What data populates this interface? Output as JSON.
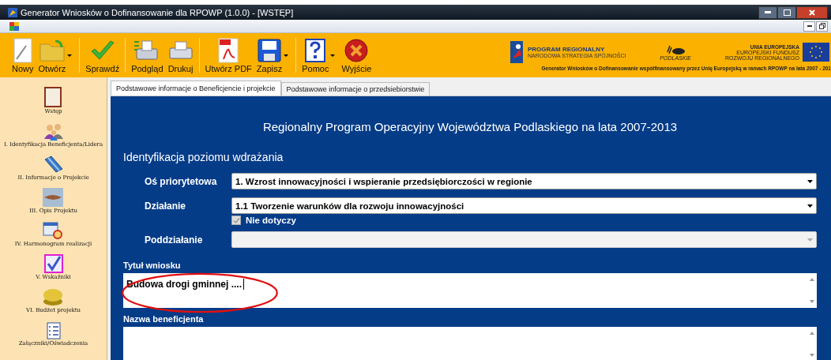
{
  "window": {
    "title": "Generator Wniosków o Dofinansowanie dla RPOWP (1.0.0) - [WSTĘP]"
  },
  "toolbar": {
    "items": [
      {
        "kind": "button",
        "label": "Nowy",
        "dropdown": false
      },
      {
        "kind": "button",
        "label": "Otwórz",
        "dropdown": true
      },
      {
        "kind": "separator"
      },
      {
        "kind": "button",
        "label": "Sprawdź",
        "dropdown": false
      },
      {
        "kind": "separator"
      },
      {
        "kind": "button",
        "label": "Podgląd",
        "dropdown": false
      },
      {
        "kind": "button",
        "label": "Drukuj",
        "dropdown": false
      },
      {
        "kind": "separator"
      },
      {
        "kind": "button",
        "label": "Utwórz PDF",
        "dropdown": false
      },
      {
        "kind": "button",
        "label": "Zapisz",
        "dropdown": true
      },
      {
        "kind": "separator"
      },
      {
        "kind": "button",
        "label": "Pomoc",
        "dropdown": true
      },
      {
        "kind": "button",
        "label": "Wyjście",
        "dropdown": false
      }
    ],
    "logos": {
      "program": "PROGRAM REGIONALNY",
      "program_sub": "NARODOWA STRATEGIA SPÓJNOŚCI",
      "region": "PODLASKIE",
      "eu": "UNIA EUROPEJSKA",
      "eu_sub1": "EUROPEJSKI FUNDUSZ",
      "eu_sub2": "ROZWOJU REGIONALNEGO"
    },
    "banner": "Generator Wniosków o Dofinansowanie współfinansowany przez Unię Europejską w ramach RPOWP na lata 2007 - 201"
  },
  "sidebar": {
    "items": [
      {
        "label": "Wstęp"
      },
      {
        "label": "I. Identyfikacja Beneficjenta/Lidera"
      },
      {
        "label": "II. Informacje o Projekcie"
      },
      {
        "label": "III. Opis Projektu"
      },
      {
        "label": "IV. Harmonogram realizacji"
      },
      {
        "label": "V. Wskaźniki"
      },
      {
        "label": "VI. Budżet projektu"
      },
      {
        "label": "Załączniki/Oświadczenia"
      }
    ]
  },
  "tabs": [
    {
      "label": "Podstawowe informacje o Beneficjencie i projekcie",
      "selected": true
    },
    {
      "label": "Podstawowe informacje o przedsiebiorstwie",
      "selected": false
    }
  ],
  "form": {
    "heading": "Regionalny Program Operacyjny Województwa Podlaskiego na lata 2007-2013",
    "section_title": "Identyfikacja poziomu wdrażania",
    "fields": [
      {
        "kind": "dropdown",
        "label": "Oś priorytetowa",
        "value": "1. Wzrost innowacyjności i wspieranie przedsiębiorczości w regionie",
        "disabled": false
      },
      {
        "kind": "dropdown",
        "label": "Działanie",
        "value": "1.1 Tworzenie warunków dla rozwoju innowacyjności",
        "disabled": false
      },
      {
        "kind": "checkbox",
        "label": "Nie dotyczy",
        "checked": true,
        "disabled": true
      },
      {
        "kind": "dropdown",
        "label": "Poddziałanie",
        "disabled": true
      }
    ],
    "text_areas": [
      {
        "label": "Tytuł wniosku",
        "value": "Budowa drogi gminnej ....",
        "focused": true
      },
      {
        "label": "Nazwa beneficjenta",
        "focused": false
      }
    ]
  }
}
